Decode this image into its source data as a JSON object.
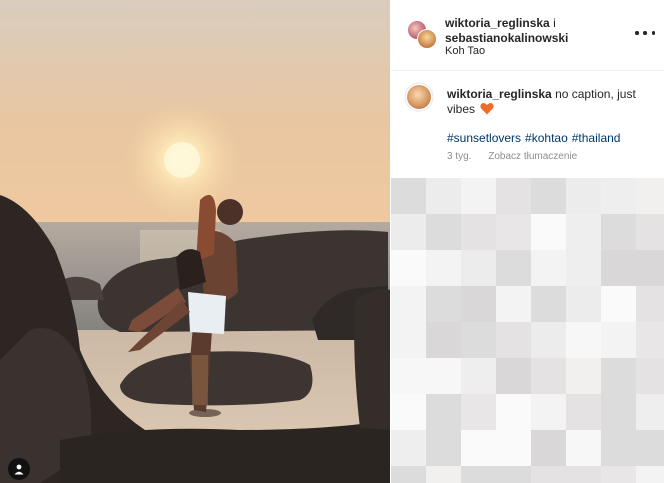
{
  "post": {
    "author_1": "wiktoria_reglinska",
    "joiner": "i",
    "author_2": "sebastianokalinowski",
    "location": "Koh Tao"
  },
  "caption": {
    "username": "wiktoria_reglinska",
    "text": "no caption, just vibes",
    "emoji_icon": "orange-heart-icon",
    "hashtags": [
      "#sunsetlovers",
      "#kohtao",
      "#thailand"
    ]
  },
  "meta": {
    "time": "3 tyg.",
    "translate": "Zobacz tłumaczenie"
  },
  "colors": {
    "link": "#00376b",
    "heart": "#ed6c2c",
    "muted": "#8e8e8e"
  }
}
